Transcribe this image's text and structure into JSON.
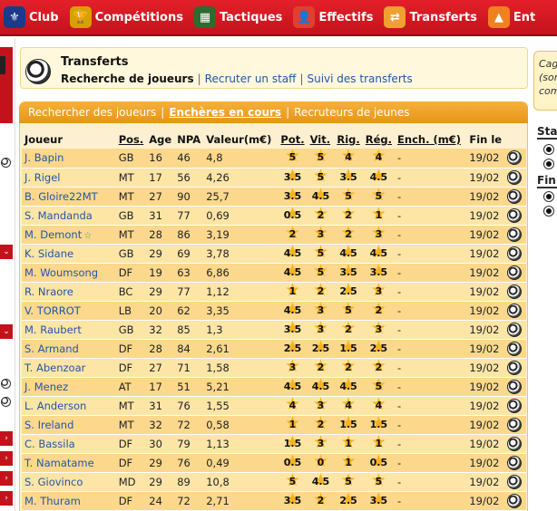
{
  "nav": [
    {
      "label": "Club",
      "icon": "club-crest-icon",
      "glyph": "⚜",
      "bg": "#1b3a8c"
    },
    {
      "label": "Compétitions",
      "icon": "trophy-icon",
      "glyph": "🏆",
      "bg": "#d6a100"
    },
    {
      "label": "Tactiques",
      "icon": "tactics-board-icon",
      "glyph": "▦",
      "bg": "#2e6b2e"
    },
    {
      "label": "Effectifs",
      "icon": "player-icon",
      "glyph": "👤",
      "bg": "#e04030"
    },
    {
      "label": "Transferts",
      "icon": "transfer-icon",
      "glyph": "⇄",
      "bg": "#f0a030"
    },
    {
      "label": "Ent",
      "icon": "coach-icon",
      "glyph": "▲",
      "bg": "#f08020"
    }
  ],
  "header": {
    "title": "Transferts",
    "current": "Recherche de joueurs",
    "links": [
      "Recruter un staff",
      "Suivi des transferts"
    ]
  },
  "tabs": [
    "Rechercher des joueurs",
    "Enchères en cours",
    "Recruteurs de jeunes"
  ],
  "active_tab": 1,
  "right_panel": {
    "box_lines": [
      "Cag",
      "(son",
      "com"
    ],
    "title1": "Sta",
    "title2": "Fin"
  },
  "columns": [
    "Joueur",
    "Pos.",
    "Age",
    "NPA",
    "Valeur(m€)",
    "Pot.",
    "Vit.",
    "Rig.",
    "Rég.",
    "Ench. (m€)",
    "Fin le",
    ""
  ],
  "rows": [
    {
      "name": "J. Bapin",
      "pos": "GB",
      "age": "16",
      "npa": "46",
      "val": "4,8",
      "pot": "5",
      "vit": "5",
      "rig": "4",
      "reg": "4",
      "ench": "-",
      "fin": "19/02"
    },
    {
      "name": "J. Rigel",
      "pos": "MT",
      "age": "17",
      "npa": "56",
      "val": "4,26",
      "pot": "3.5",
      "vit": "5",
      "rig": "3.5",
      "reg": "4.5",
      "ench": "-",
      "fin": "19/02"
    },
    {
      "name": "B. Gloire22MT",
      "pos": "MT",
      "age": "27",
      "npa": "90",
      "val": "25,7",
      "pot": "3.5",
      "vit": "4.5",
      "rig": "5",
      "reg": "5",
      "ench": "-",
      "fin": "19/02"
    },
    {
      "name": "S. Mandanda",
      "pos": "GB",
      "age": "31",
      "npa": "77",
      "val": "0,69",
      "pot": "0.5",
      "vit": "2",
      "rig": "2",
      "reg": "1",
      "ench": "-",
      "fin": "19/02"
    },
    {
      "name": "M. Demont",
      "fav": true,
      "pos": "MT",
      "age": "28",
      "npa": "86",
      "val": "3,19",
      "pot": "2",
      "vit": "3",
      "rig": "2",
      "reg": "3",
      "ench": "-",
      "fin": "19/02"
    },
    {
      "name": "K. Sidane",
      "pos": "GB",
      "age": "29",
      "npa": "69",
      "val": "3,78",
      "pot": "4.5",
      "vit": "5",
      "rig": "4.5",
      "reg": "4.5",
      "ench": "-",
      "fin": "19/02"
    },
    {
      "name": "M. Woumsong",
      "pos": "DF",
      "age": "19",
      "npa": "63",
      "val": "6,86",
      "pot": "4.5",
      "vit": "5",
      "rig": "3.5",
      "reg": "3.5",
      "ench": "-",
      "fin": "19/02"
    },
    {
      "name": "R. Nraore",
      "pos": "BC",
      "age": "29",
      "npa": "77",
      "val": "1,12",
      "pot": "1",
      "vit": "2",
      "rig": "2.5",
      "reg": "3",
      "ench": "-",
      "fin": "19/02"
    },
    {
      "name": "V. TORROT",
      "pos": "LB",
      "age": "20",
      "npa": "62",
      "val": "3,35",
      "pot": "4.5",
      "vit": "3",
      "rig": "5",
      "reg": "2",
      "ench": "-",
      "fin": "19/02"
    },
    {
      "name": "M. Raubert",
      "pos": "GB",
      "age": "32",
      "npa": "85",
      "val": "1,3",
      "pot": "3.5",
      "vit": "3",
      "rig": "2",
      "reg": "3",
      "ench": "-",
      "fin": "19/02"
    },
    {
      "name": "S. Armand",
      "pos": "DF",
      "age": "28",
      "npa": "84",
      "val": "2,61",
      "pot": "2.5",
      "vit": "2.5",
      "rig": "1.5",
      "reg": "2.5",
      "ench": "-",
      "fin": "19/02"
    },
    {
      "name": "T. Abenzoar",
      "pos": "DF",
      "age": "27",
      "npa": "71",
      "val": "1,58",
      "pot": "3",
      "vit": "2",
      "rig": "2",
      "reg": "2",
      "ench": "-",
      "fin": "19/02"
    },
    {
      "name": "J. Menez",
      "pos": "AT",
      "age": "17",
      "npa": "51",
      "val": "5,21",
      "pot": "4.5",
      "vit": "4.5",
      "rig": "4.5",
      "reg": "5",
      "ench": "-",
      "fin": "19/02"
    },
    {
      "name": "L. Anderson",
      "pos": "MT",
      "age": "31",
      "npa": "76",
      "val": "1,55",
      "pot": "4",
      "vit": "3",
      "rig": "4",
      "reg": "4",
      "ench": "-",
      "fin": "19/02"
    },
    {
      "name": "S. Ireland",
      "pos": "MT",
      "age": "32",
      "npa": "72",
      "val": "0,58",
      "pot": "1",
      "vit": "2",
      "rig": "1.5",
      "reg": "1.5",
      "ench": "-",
      "fin": "19/02"
    },
    {
      "name": "C. Bassila",
      "pos": "DF",
      "age": "30",
      "npa": "79",
      "val": "1,13",
      "pot": "1.5",
      "vit": "3",
      "rig": "1",
      "reg": "1",
      "ench": "-",
      "fin": "19/02"
    },
    {
      "name": "T. Namatame",
      "pos": "DF",
      "age": "29",
      "npa": "76",
      "val": "0,49",
      "pot": "0.5",
      "vit": "0",
      "rig": "1",
      "reg": "0.5",
      "ench": "-",
      "fin": "19/02"
    },
    {
      "name": "S. Giovinco",
      "pos": "MD",
      "age": "29",
      "npa": "89",
      "val": "10,8",
      "pot": "5",
      "vit": "4.5",
      "rig": "5",
      "reg": "5",
      "ench": "-",
      "fin": "19/02"
    },
    {
      "name": "M. Thuram",
      "pos": "DF",
      "age": "24",
      "npa": "72",
      "val": "2,71",
      "pot": "3.5",
      "vit": "2",
      "rig": "2.5",
      "reg": "3.5",
      "ench": "-",
      "fin": "19/02"
    }
  ]
}
